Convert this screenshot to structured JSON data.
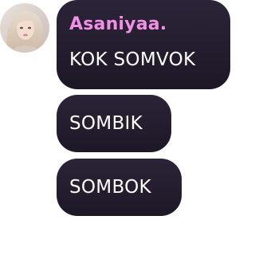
{
  "chat": {
    "accent_name_color": "#f08fe4",
    "bubble_color": "#231d2e",
    "messages": [
      {
        "sender": "Asaniyaa.",
        "text": "KOK SOMVOK"
      },
      {
        "text": "SOMBIK"
      },
      {
        "text": "SOMBOK"
      }
    ]
  }
}
